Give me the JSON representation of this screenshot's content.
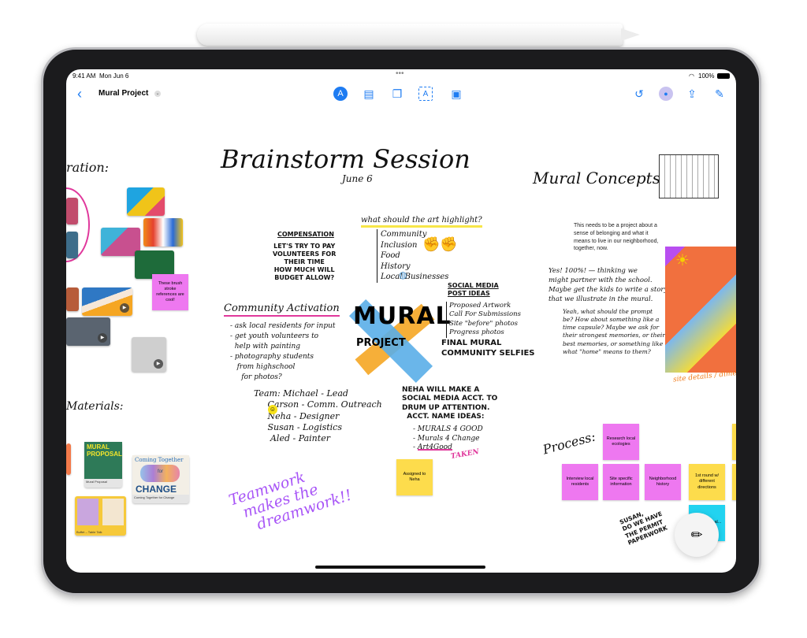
{
  "status_bar": {
    "time": "9:41 AM",
    "date": "Mon Jun 6",
    "battery": "100%"
  },
  "toolbar": {
    "board_title": "Mural Project",
    "icons": [
      "back-chevron-icon",
      "pen-markup-icon",
      "sticky-note-icon",
      "shapes-icon",
      "text-box-icon",
      "media-icon",
      "undo-icon",
      "collaborators-icon",
      "share-icon",
      "new-board-icon"
    ]
  },
  "canvas": {
    "brainstorm_title": "Brainstorm Session",
    "brainstorm_date": "June 6",
    "inspiration_heading": "ration:",
    "materials_heading": "Materials:",
    "compensation_heading": "COMPENSATION",
    "compensation_body": "LET'S TRY TO PAY\nVOLUNTEERS FOR\nTHEIR TIME\nHOW MUCH WILL\nBUDGET ALLOW?",
    "highlight_question": "what should the art highlight?",
    "highlight_items": "Community\nInclusion\nFood\nHistory\nLocal Businesses",
    "community_heading": "Community Activation",
    "community_items": "- ask local residents for input\n- get youth volunteers to\n  help with painting\n- photography students\n   from highschool\n     for photos?",
    "mural_logo_line1": "MURAL",
    "mural_logo_line2": "PROJECT",
    "social_heading": "SOCIAL MEDIA\nPOST IDEAS",
    "social_items": "Proposed Artwork\nCall For Submissions\nSite \"before\" photos\nProgress photos",
    "social_final": "FINAL MURAL\nCOMMUNITY SELFIES",
    "team": "Team: Michael - Lead\n     Carson - Comm. Outreach\n     Neha - Designer\n     Susan - Logistics\n      Aled - Painter",
    "neha_note": "NEHA WILL MAKE A\nSOCIAL MEDIA ACCT. TO\nDRUM UP ATTENTION.\n  ACCT. NAME IDEAS:",
    "name_ideas": "- MURALS 4 GOOD\n- Murals 4 Change\n- Art4Good",
    "taken": "TAKEN",
    "teamwork": "Teamwork\n  makes the\n    dreamwork!!",
    "mural_concepts": "Mural Concepts",
    "concept_text": "This needs to be a project about a sense of belonging and what it means to live in our neighborhood, together, now.",
    "reply1": "Yes! 100%! — thinking we\nmight partner with the school.\nMaybe get the kids to write a story\nthat we illustrate in the mural.",
    "reply2": "Yeah, what should the prompt\nbe? How about something like a\ntime capsule? Maybe we ask for\ntheir strongest memories, or their\nbest memories, or something like\nwhat \"home\" means to them?",
    "site_details": "site details / dimen",
    "process_heading": "Process:",
    "susan_note": "SUSAN,\nDO WE HAVE\nTHE PERMIT\nPAPERWORK",
    "stickies": {
      "brush": "These brush stroke references are cool!",
      "assigned": "Assigned to Neha",
      "research": "Research local ecologies",
      "interview": "Interview local residents",
      "site": "Site specific information",
      "history": "Neighborhood history",
      "first_round": "1st round w/ different directions",
      "print": "Print the final..."
    },
    "docs": {
      "proposal_cover": "MURAL\nPROPOSAL",
      "proposal_name": "Mural Proposal",
      "change_cover_top": "Coming  Together",
      "change_cover_for": "for",
      "change_cover_main": "CHANGE",
      "change_name": "Coming Together for Change",
      "buffet_name": "Buffet – Table Talk"
    }
  },
  "colors": {
    "accent": "#1e7cf2",
    "pink": "#ee78f0",
    "yellow": "#fddc4c",
    "cyan": "#22d3f0",
    "purple": "#a855f7",
    "magenta": "#e0389c"
  }
}
